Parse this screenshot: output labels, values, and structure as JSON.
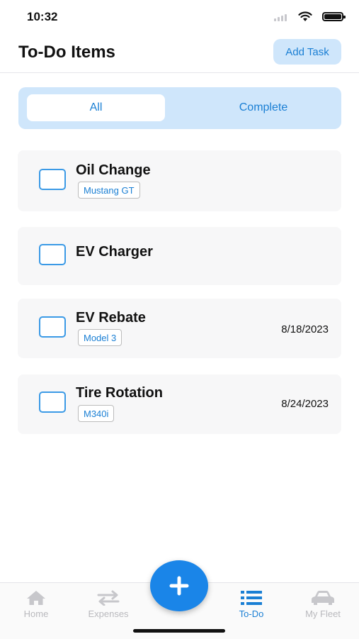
{
  "status_bar": {
    "time": "10:32"
  },
  "header": {
    "title": "To-Do Items",
    "add_task_label": "Add Task"
  },
  "segments": [
    {
      "label": "All",
      "selected": true
    },
    {
      "label": "Complete",
      "selected": false
    }
  ],
  "todos": [
    {
      "title": "Oil Change",
      "tag": "Mustang GT",
      "date": ""
    },
    {
      "title": "EV Charger",
      "tag": "",
      "date": ""
    },
    {
      "title": "EV Rebate",
      "tag": "Model 3",
      "date": "8/18/2023"
    },
    {
      "title": "Tire Rotation",
      "tag": "M340i",
      "date": "8/24/2023"
    }
  ],
  "tabbar": {
    "tabs": [
      {
        "label": "Home",
        "icon": "house-icon",
        "active": false
      },
      {
        "label": "Expenses",
        "icon": "arrows-exchange-icon",
        "active": false
      },
      {
        "label": "To-Do",
        "icon": "list-icon",
        "active": true
      },
      {
        "label": "My Fleet",
        "icon": "car-icon",
        "active": false
      }
    ],
    "fab_icon": "plus-icon"
  },
  "colors": {
    "accent": "#1a85e8",
    "accent_light": "#cfe6fb",
    "inactive": "#b9b9bd"
  }
}
